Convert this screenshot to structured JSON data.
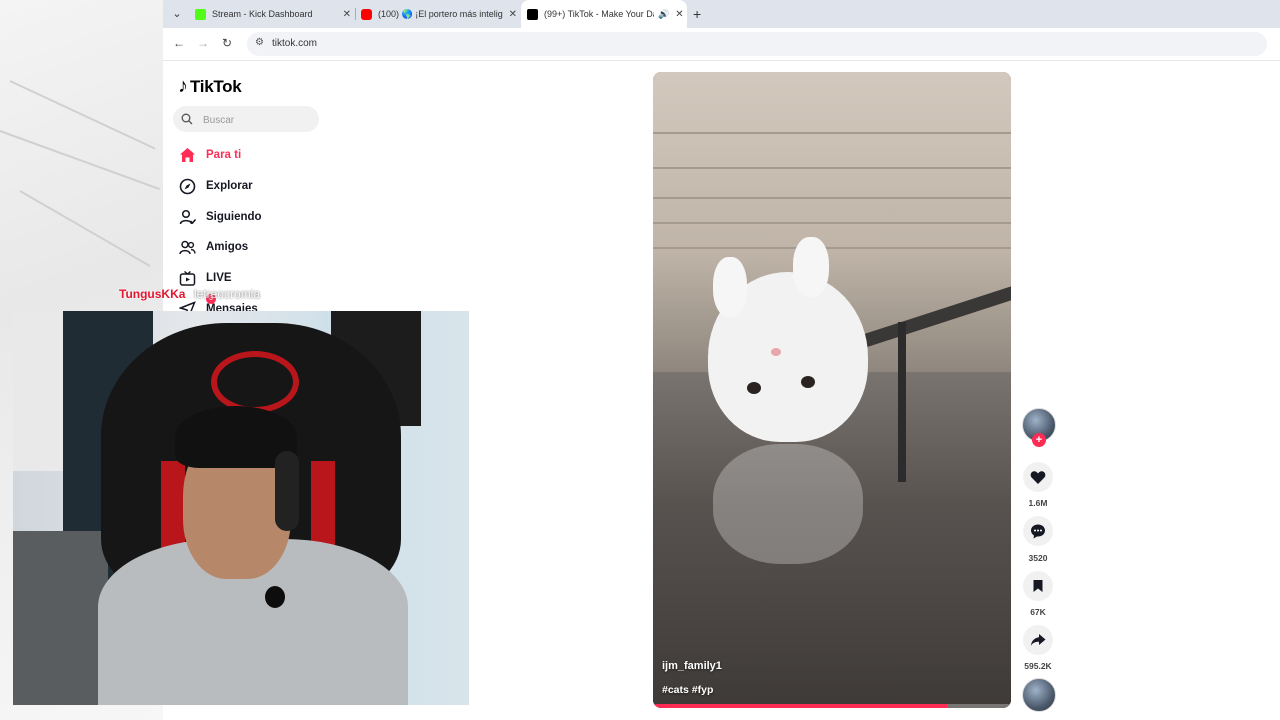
{
  "browser": {
    "tabs": [
      {
        "title": "Stream - Kick Dashboard",
        "favicon_color": "#53fc18",
        "active": false
      },
      {
        "title": "(100) 🌎 ¡El portero más intelig",
        "favicon_color": "#ff0000",
        "active": false
      },
      {
        "title": "(99+) TikTok - Make Your Da",
        "favicon_color": "#000000",
        "active": true
      }
    ],
    "new_tab_label": "+",
    "url": "tiktok.com"
  },
  "tiktok": {
    "logo": "TikTok",
    "search_placeholder": "Buscar",
    "nav": [
      {
        "label": "Para ti",
        "icon": "home-icon",
        "active": true
      },
      {
        "label": "Explorar",
        "icon": "compass-icon",
        "active": false
      },
      {
        "label": "Siguiendo",
        "icon": "following-icon",
        "active": false
      },
      {
        "label": "Amigos",
        "icon": "friends-icon",
        "active": false
      },
      {
        "label": "LIVE",
        "icon": "live-icon",
        "active": false
      },
      {
        "label": "Mensajes",
        "icon": "messages-icon",
        "active": false,
        "badge": "3"
      }
    ],
    "video": {
      "author": "ijm_family1",
      "hashtags": "#cats #fyp",
      "progress": 0.82
    },
    "actions": {
      "likes": "1.6M",
      "comments": "3520",
      "saves": "67K",
      "shares": "595.2K"
    }
  },
  "stream_overlay": {
    "streamer_name": "TungusKKa",
    "subtitle": "letreocromia"
  },
  "colors": {
    "accent": "#fe2c55",
    "tab_strip": "#dee3ec"
  }
}
